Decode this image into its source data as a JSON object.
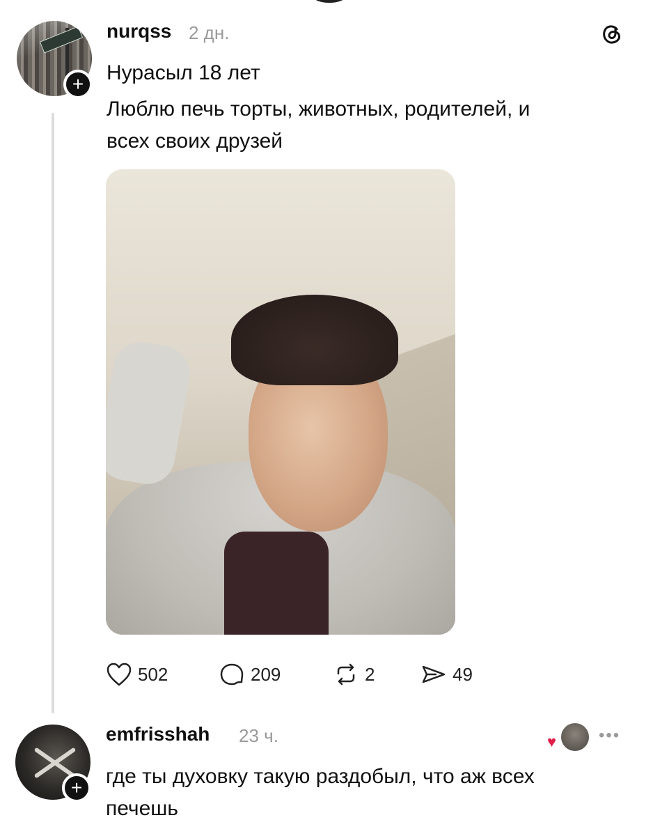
{
  "post": {
    "username": "nurqss",
    "time": "2 дн.",
    "name_line": "Нурасыл 18 лет",
    "body": "Люблю печь торты, животных, родителей, и\nвсех своих друзей",
    "stats": {
      "likes": "502",
      "comments": "209",
      "reposts": "2",
      "shares": "49"
    }
  },
  "reply": {
    "username": "emfrisshah",
    "time": "23 ч.",
    "body": "где ты духовку такую раздобыл, что аж всех\nпечешь"
  },
  "icons": {
    "threads": "threads-logo-icon",
    "like": "heart-icon",
    "comment": "comment-bubble-icon",
    "repost": "repost-icon",
    "share": "send-icon",
    "more": "more-dots-icon",
    "follow": "plus-icon"
  },
  "colors": {
    "text": "#111111",
    "muted": "#9a9a9a",
    "like_red": "#e0204a",
    "thread_line": "#dcdcdc"
  }
}
